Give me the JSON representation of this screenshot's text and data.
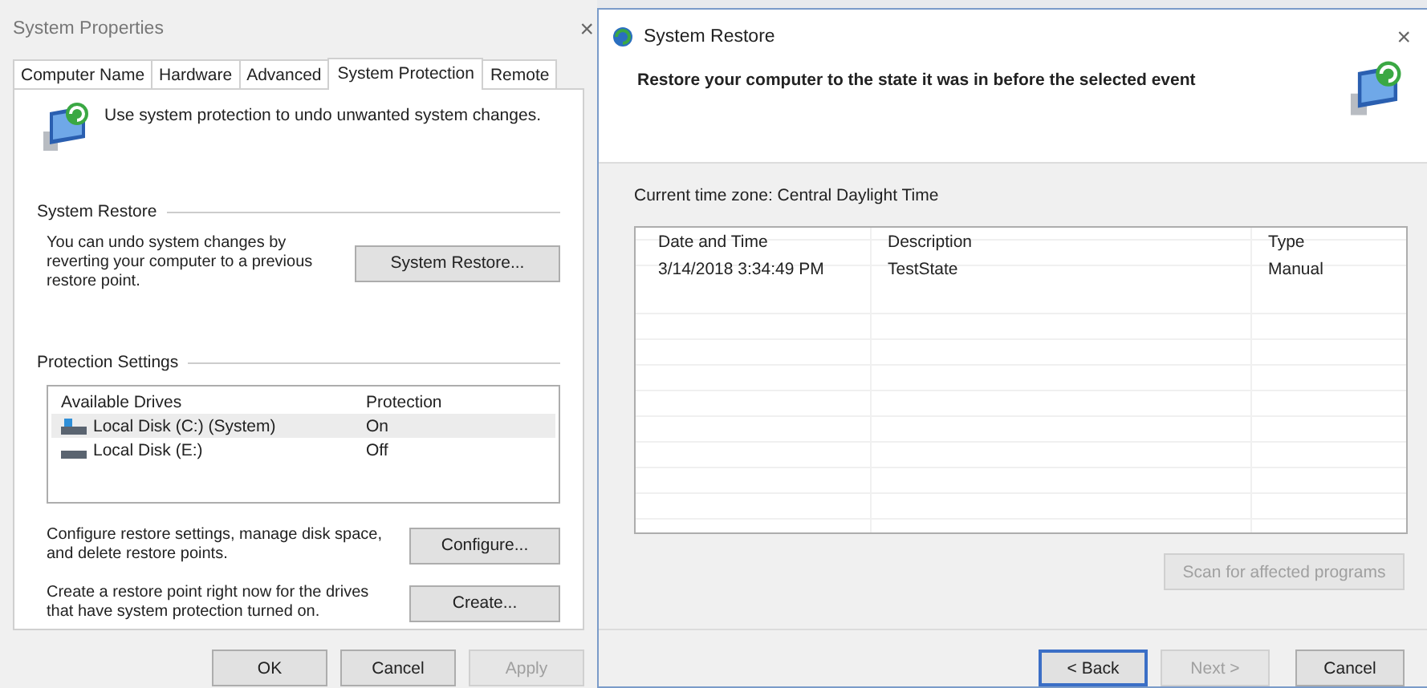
{
  "left_window": {
    "title": "System Properties",
    "close": "×",
    "tabs": [
      {
        "label": "Computer Name",
        "selected": false
      },
      {
        "label": "Hardware",
        "selected": false
      },
      {
        "label": "Advanced",
        "selected": false
      },
      {
        "label": "System Protection",
        "selected": true
      },
      {
        "label": "Remote",
        "selected": false
      }
    ],
    "intro": "Use system protection to undo unwanted system changes.",
    "restore_group": {
      "title": "System Restore",
      "text": "You can undo system changes by reverting your computer to a previous restore point.",
      "button": "System Restore..."
    },
    "protection_group": {
      "title": "Protection Settings",
      "columns": [
        "Available Drives",
        "Protection"
      ],
      "drives": [
        {
          "kind": "system",
          "name": "Local Disk (C:) (System)",
          "protection": "On",
          "selected": true
        },
        {
          "kind": "data",
          "name": "Local Disk (E:)",
          "protection": "Off",
          "selected": false
        }
      ],
      "actions": [
        {
          "text": "Configure restore settings, manage disk space, and delete restore points.",
          "button": "Configure..."
        },
        {
          "text": "Create a restore point right now for the drives that have system protection turned on.",
          "button": "Create..."
        }
      ]
    },
    "buttons": [
      {
        "label": "OK",
        "disabled": false
      },
      {
        "label": "Cancel",
        "disabled": false
      },
      {
        "label": "Apply",
        "disabled": true
      }
    ]
  },
  "right_window": {
    "title": "System Restore",
    "close": "×",
    "heading": "Restore your computer to the state it was in before the selected event",
    "timezone": "Current time zone: Central Daylight Time",
    "columns": [
      "Date and Time",
      "Description",
      "Type"
    ],
    "rows": [
      {
        "cells": [
          "3/14/2018 3:34:49 PM",
          "TestState",
          "Manual"
        ],
        "selected": false
      }
    ],
    "scan_button": {
      "label": "Scan for affected programs",
      "disabled": true
    },
    "buttons": [
      {
        "label": "< Back",
        "disabled": false,
        "default": true
      },
      {
        "label": "Next >",
        "disabled": true,
        "default": false
      },
      {
        "label": "Cancel",
        "disabled": false,
        "default": false
      }
    ]
  }
}
